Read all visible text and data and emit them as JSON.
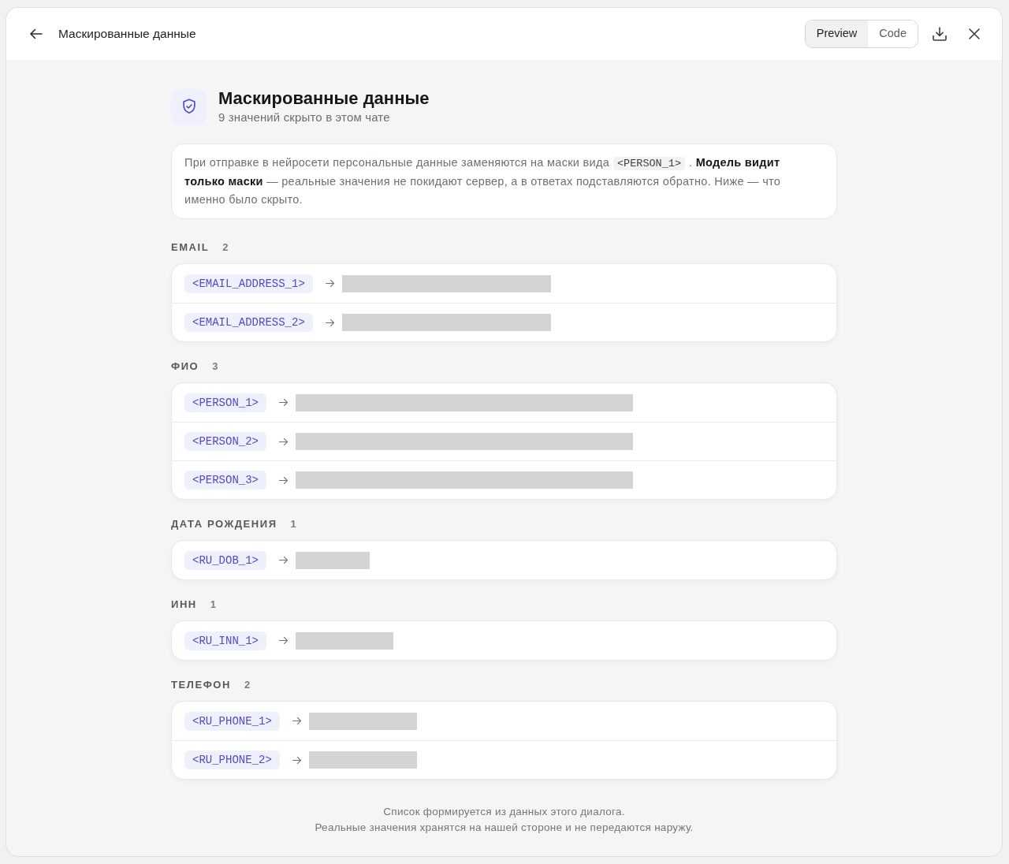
{
  "window": {
    "title": "Маскированные данные"
  },
  "view_toggle": [
    {
      "label": "Preview",
      "selected": true
    },
    {
      "label": "Code",
      "selected": false
    }
  ],
  "header": {
    "title": "Маскированные данные",
    "subtitle": "9 значений скрыто в этом чате"
  },
  "info": {
    "parts": [
      {
        "kind": "text",
        "text": "При отправке в нейросети персональные данные заменяются на маски вида"
      },
      {
        "kind": "code",
        "text": "<PERSON_1>"
      },
      {
        "kind": "text",
        "text": ". **Модель видит только маски** — реальные значения не покидают сервер, а в ответах подставляются обратно. Ниже — что именно было скрыто."
      }
    ]
  },
  "sections": [
    {
      "label": "EMAIL",
      "count": "2",
      "kind": "email",
      "items": [
        {
          "mask": "<EMAIL_ADDRESS_1>"
        },
        {
          "mask": "<EMAIL_ADDRESS_2>"
        }
      ]
    },
    {
      "label": "ФИО",
      "count": "3",
      "kind": "person",
      "items": [
        {
          "mask": "<PERSON_1>"
        },
        {
          "mask": "<PERSON_2>"
        },
        {
          "mask": "<PERSON_3>"
        }
      ]
    },
    {
      "label": "ДАТА РОЖДЕНИЯ",
      "count": "1",
      "kind": "birth_date",
      "items": [
        {
          "mask": "<RU_DOB_1>"
        }
      ]
    },
    {
      "label": "ИНН",
      "count": "1",
      "kind": "tax_id",
      "items": [
        {
          "mask": "<RU_INN_1>"
        }
      ]
    },
    {
      "label": "ТЕЛЕФОН",
      "count": "2",
      "kind": "phone",
      "items": [
        {
          "mask": "<RU_PHONE_1>"
        },
        {
          "mask": "<RU_PHONE_2>"
        }
      ]
    }
  ],
  "footer": [
    "Список формируется из данных этого диалога.",
    "Реальные значения хранятся на нашей стороне и не передаются наружу."
  ]
}
